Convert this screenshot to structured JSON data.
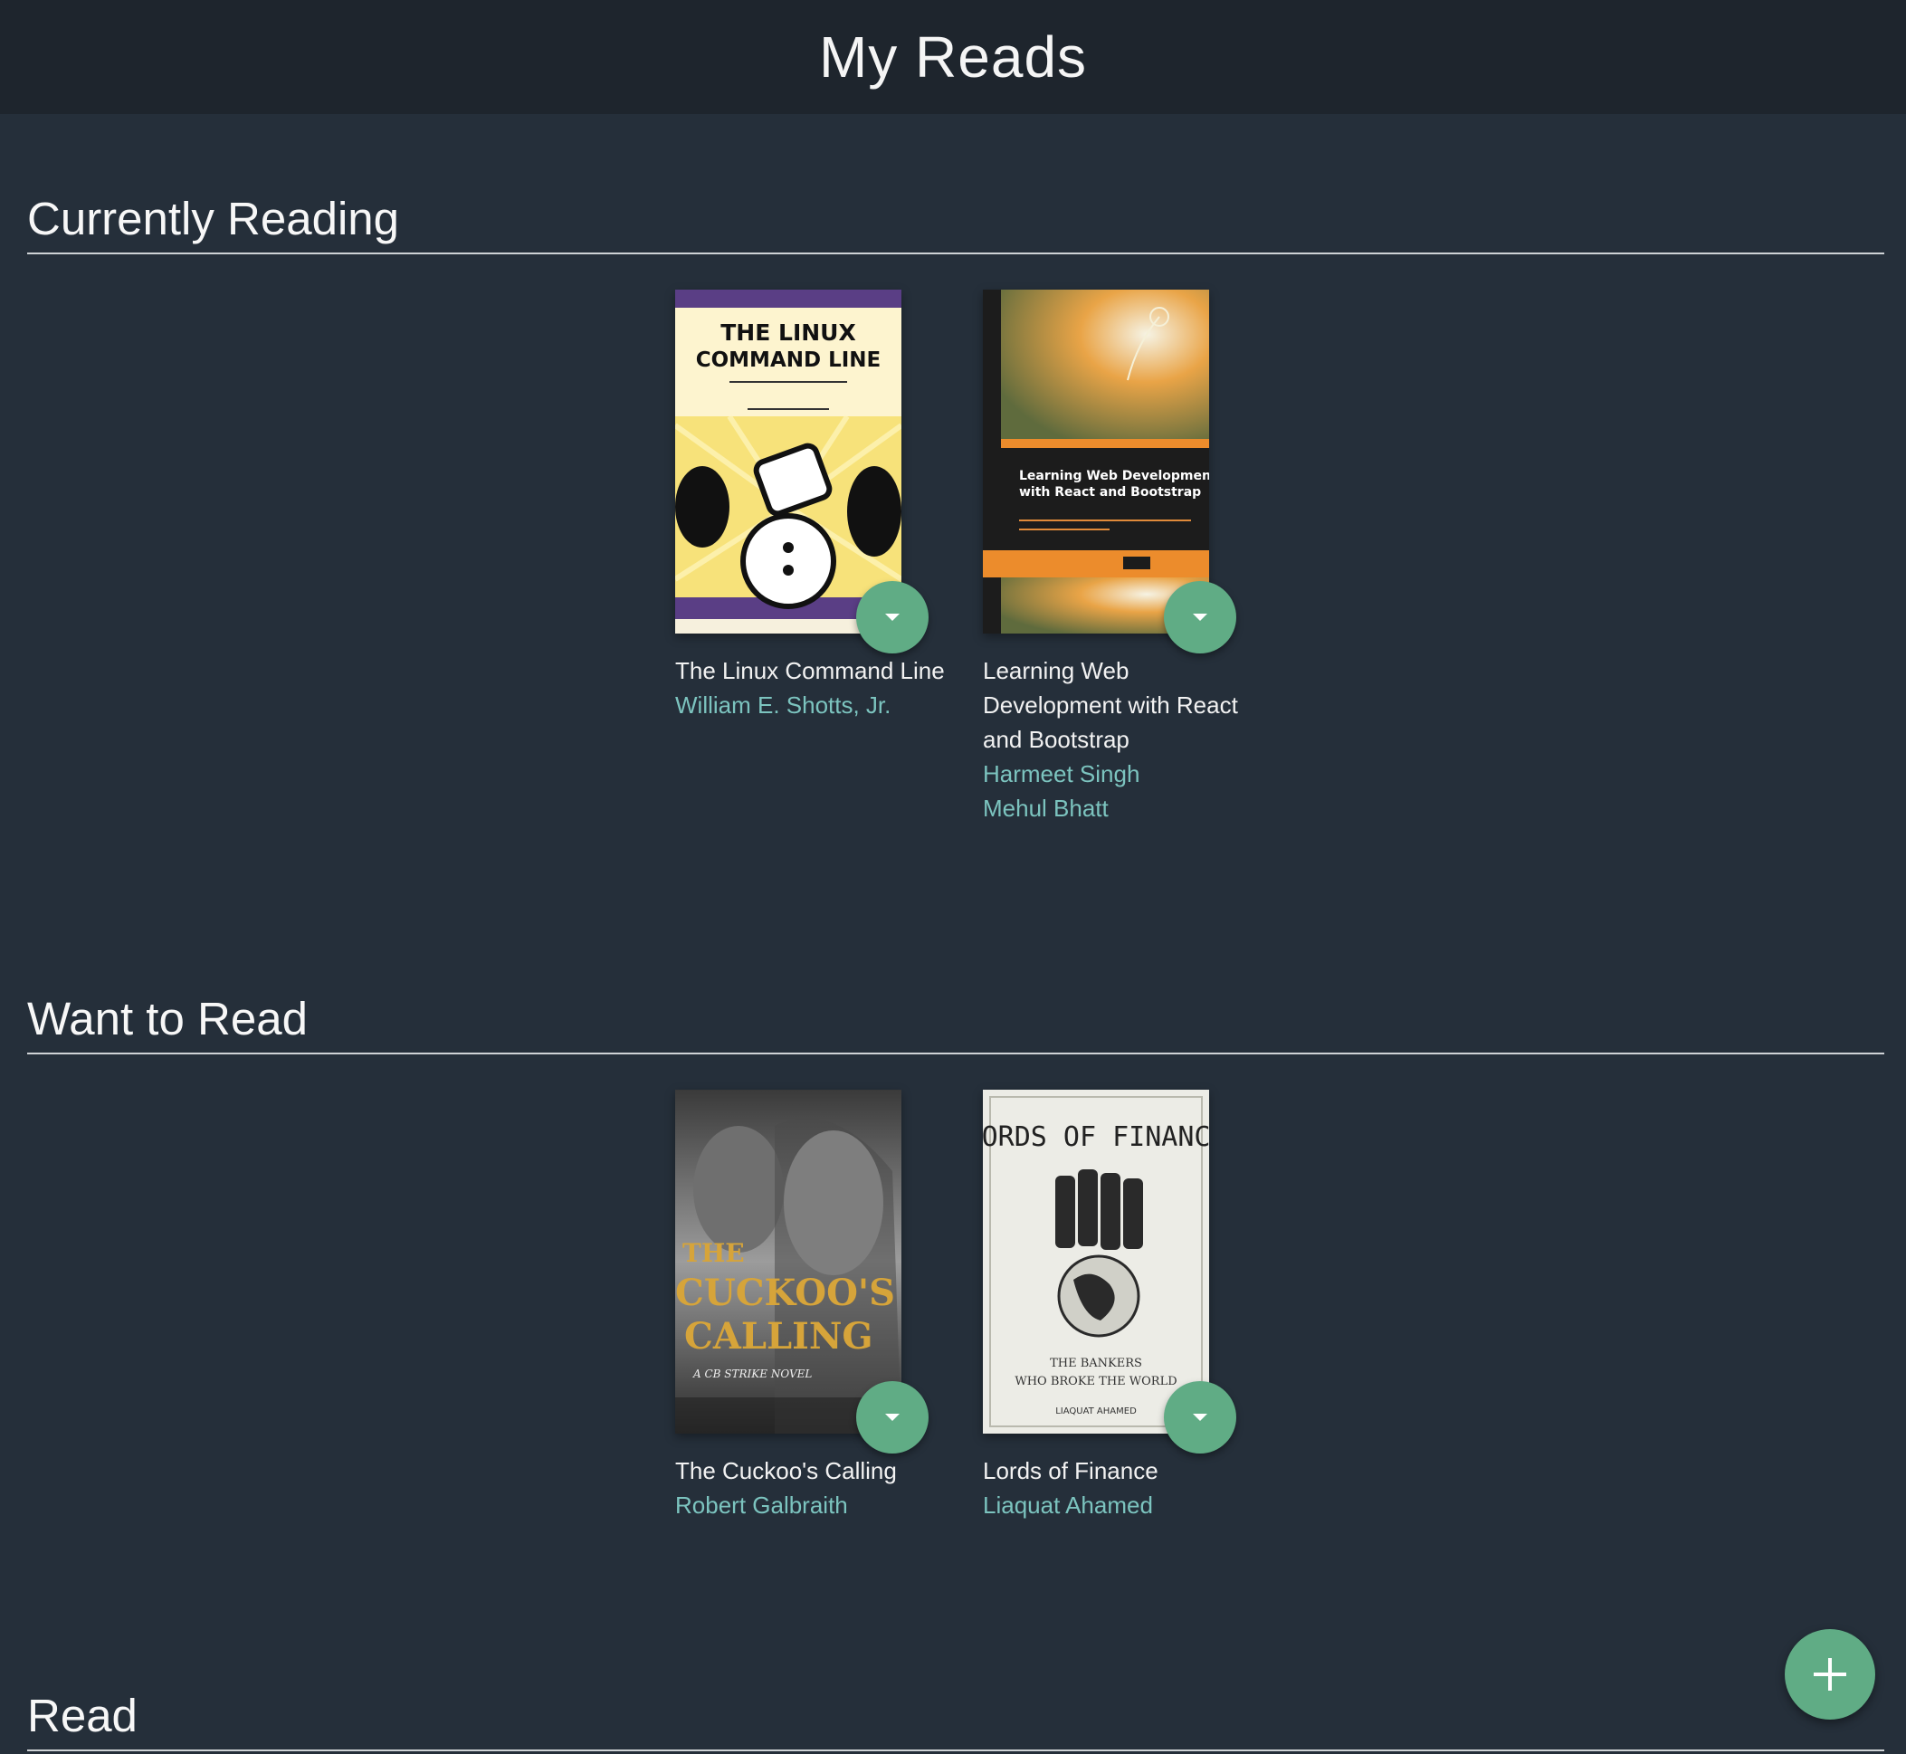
{
  "app": {
    "title": "My Reads"
  },
  "shelves": [
    {
      "title": "Currently Reading",
      "books": [
        {
          "title": "The Linux Command Line",
          "authors": [
            "William E. Shotts, Jr."
          ],
          "cover_text": [
            "THE LINUX",
            "COMMAND LINE"
          ]
        },
        {
          "title": "Learning Web Development with React and Bootstrap",
          "authors": [
            "Harmeet Singh",
            "Mehul Bhatt"
          ],
          "cover_text": [
            "Learning Web Development",
            "with React and Bootstrap"
          ]
        }
      ]
    },
    {
      "title": "Want to Read",
      "books": [
        {
          "title": "The Cuckoo's Calling",
          "authors": [
            "Robert Galbraith"
          ],
          "cover_text": [
            "THE",
            "CUCKOO'S",
            "CALLING",
            "A CB STRIKE NOVEL"
          ]
        },
        {
          "title": "Lords of Finance",
          "authors": [
            "Liaquat Ahamed"
          ],
          "cover_text": [
            "LORDS OF FINANCE",
            "THE BANKERS",
            "WHO BROKE THE WORLD",
            "LIAQUAT AHAMED"
          ]
        }
      ]
    },
    {
      "title": "Read",
      "books": []
    }
  ],
  "colors": {
    "background": "#252f3a",
    "header": "#1e252d",
    "accent": "#60ac85",
    "author": "#7cc4bf"
  },
  "icons": {
    "shelf_changer": "arrow-drop-down-icon",
    "add": "plus-icon"
  }
}
